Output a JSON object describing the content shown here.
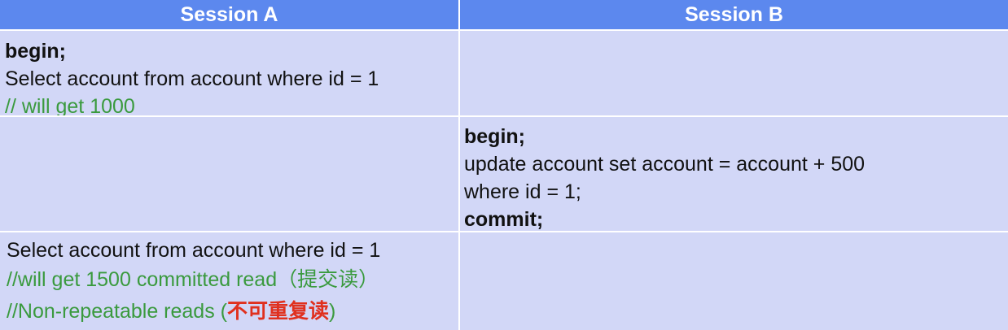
{
  "header": {
    "session_a": "Session A",
    "session_b": "Session B"
  },
  "rows": [
    {
      "a": {
        "line1": "begin;",
        "line2": "Select account from account where id = 1",
        "line3": "// will get 1000"
      }
    },
    {
      "b": {
        "line1": "begin;",
        "line2": "update account set account = account + 500",
        "line3": "where id = 1;",
        "line4": "commit;"
      }
    },
    {
      "a": {
        "line1": "Select account from account where id = 1",
        "line2": "//will get 1500 committed read（提交读）",
        "line3_prefix": "//Non-repeatable reads (",
        "line3_highlight": "不可重复读",
        "line3_suffix": ")"
      }
    }
  ],
  "colors": {
    "header_bg": "#5c88ee",
    "cell_bg": "#d2d7f7",
    "comment": "#3a9a3e",
    "highlight": "#e0301e"
  }
}
